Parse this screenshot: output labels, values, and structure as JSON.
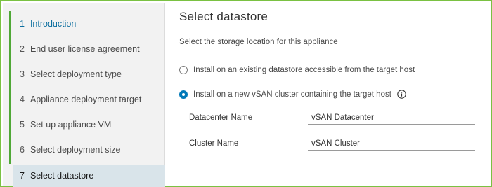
{
  "steps": [
    {
      "num": "1",
      "label": "Introduction"
    },
    {
      "num": "2",
      "label": "End user license agreement"
    },
    {
      "num": "3",
      "label": "Select deployment type"
    },
    {
      "num": "4",
      "label": "Appliance deployment target"
    },
    {
      "num": "5",
      "label": "Set up appliance VM"
    },
    {
      "num": "6",
      "label": "Select deployment size"
    },
    {
      "num": "7",
      "label": "Select datastore"
    }
  ],
  "page": {
    "title": "Select datastore",
    "description": "Select the storage location for this appliance"
  },
  "options": [
    {
      "label": "Install on an existing datastore accessible from the target host",
      "selected": false
    },
    {
      "label": "Install on a new vSAN cluster containing the target host",
      "selected": true
    }
  ],
  "fields": {
    "datacenter": {
      "label": "Datacenter Name",
      "value": "vSAN Datacenter"
    },
    "cluster": {
      "label": "Cluster Name",
      "value": "vSAN Cluster"
    }
  },
  "colors": {
    "accent_green": "#4fa836",
    "link_blue": "#0a6d9e",
    "radio_blue": "#0079b8",
    "active_step_bg": "#d9e4ea"
  },
  "icons": {
    "info": "info-icon"
  }
}
